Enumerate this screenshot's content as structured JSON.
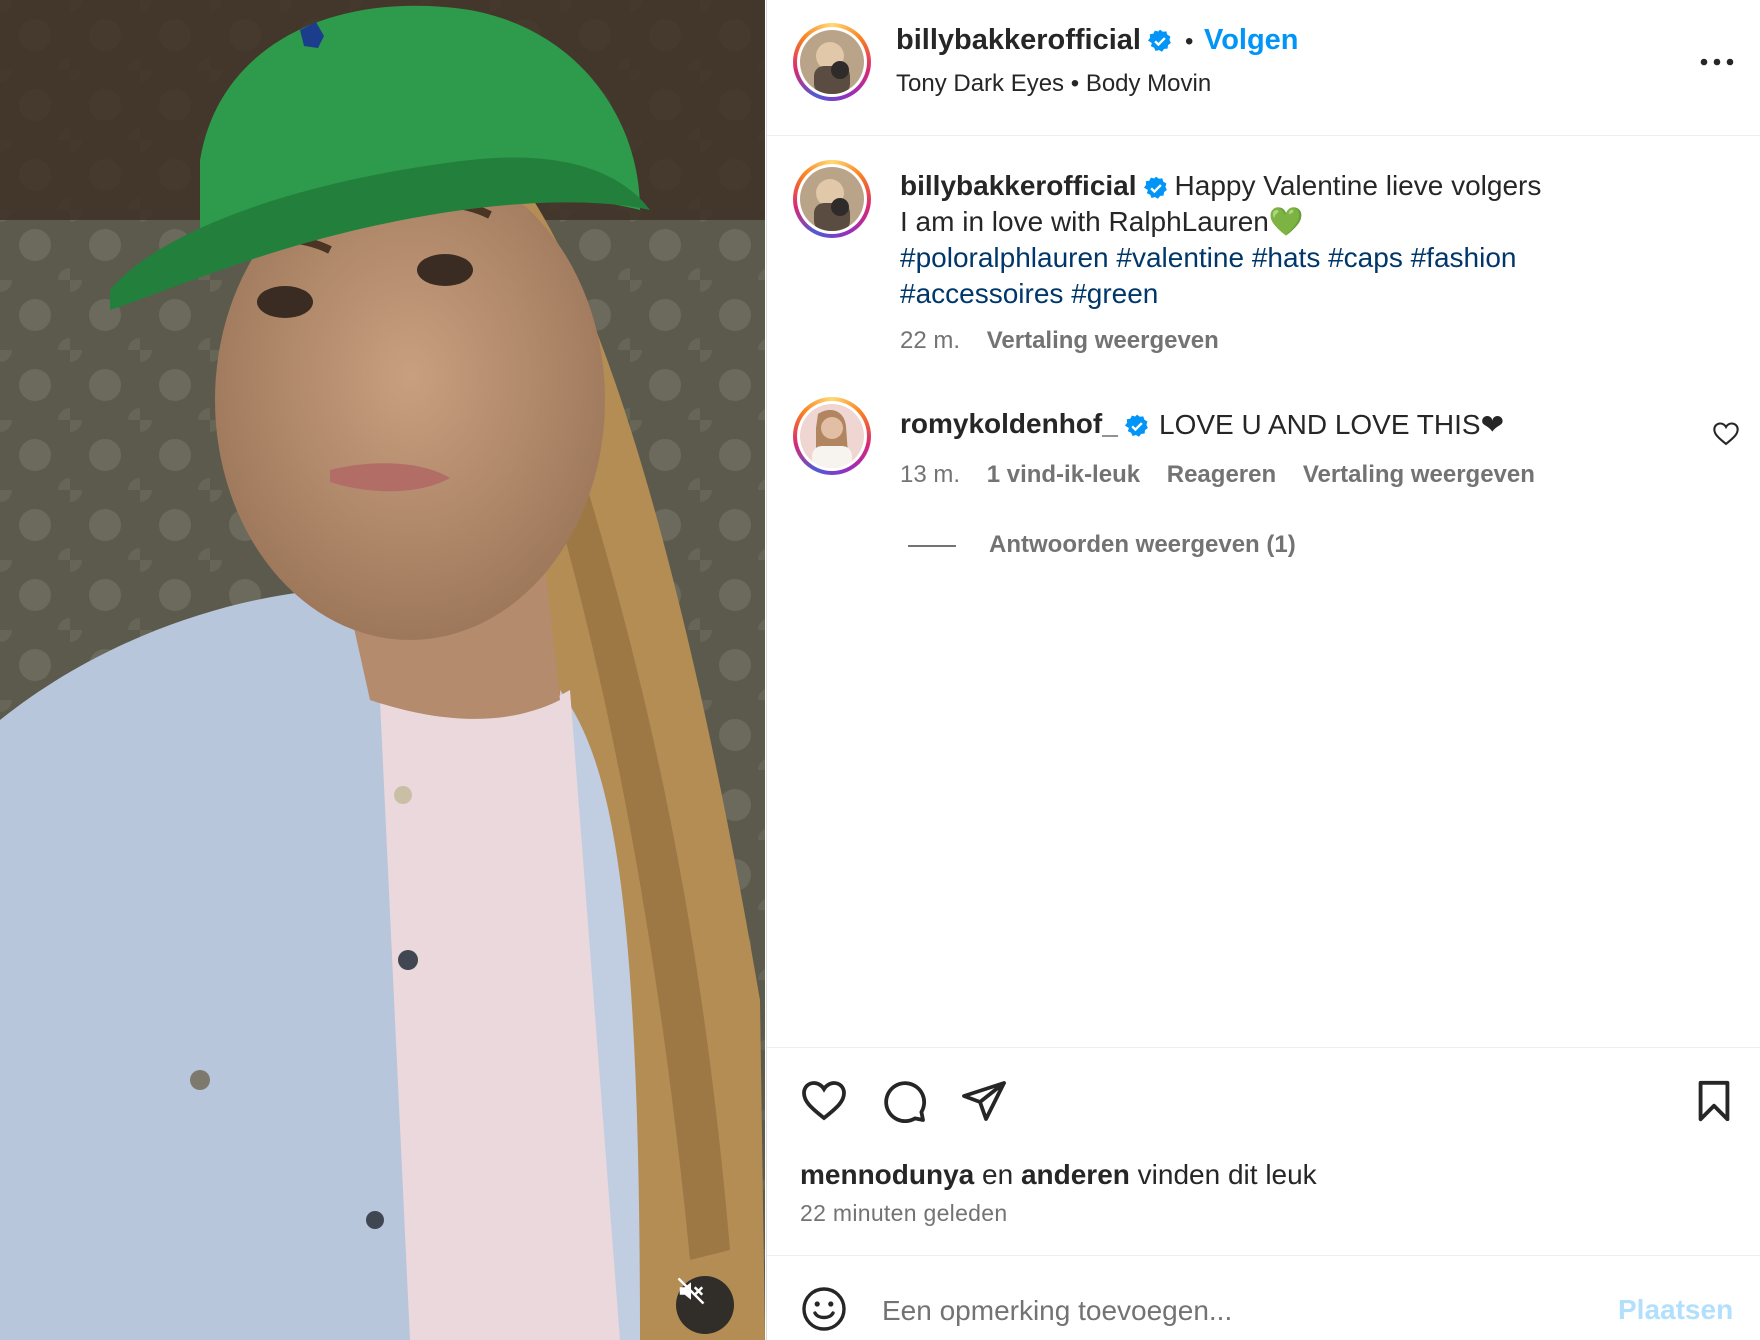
{
  "post": {
    "username": "billybakkerofficial",
    "follow_label": "Volgen",
    "audio_artist": "Tony Dark Eyes",
    "audio_track": "Body Movin",
    "more_icon": "more-horizontal-icon"
  },
  "caption": {
    "username": "billybakkerofficial",
    "line1": "Happy Valentine lieve volgers",
    "line2": "I am in love with RalphLauren💚",
    "hashtags": [
      "#poloralphlauren",
      "#valentine",
      "#hats",
      "#caps",
      "#fashion",
      "#accessoires",
      "#green"
    ],
    "time": "22 m.",
    "translate": "Vertaling weergeven"
  },
  "comment": {
    "username": "romykoldenhof_",
    "text": "LOVE U AND LOVE THIS❤",
    "time": "13 m.",
    "likes": "1 vind-ik-leuk",
    "reply": "Reageren",
    "translate": "Vertaling weergeven",
    "view_replies": "Antwoorden weergeven (1)"
  },
  "engagement": {
    "liker": "mennodunya",
    "and": "en",
    "others": "anderen",
    "suffix": "vinden dit leuk",
    "time_ago": "22 minuten geleden"
  },
  "composer": {
    "placeholder": "Een opmerking toevoegen...",
    "post_label": "Plaatsen"
  },
  "colors": {
    "link_blue": "#0095f6",
    "hashtag": "#00376b",
    "muted": "#737373",
    "verified": "#0095f6"
  }
}
